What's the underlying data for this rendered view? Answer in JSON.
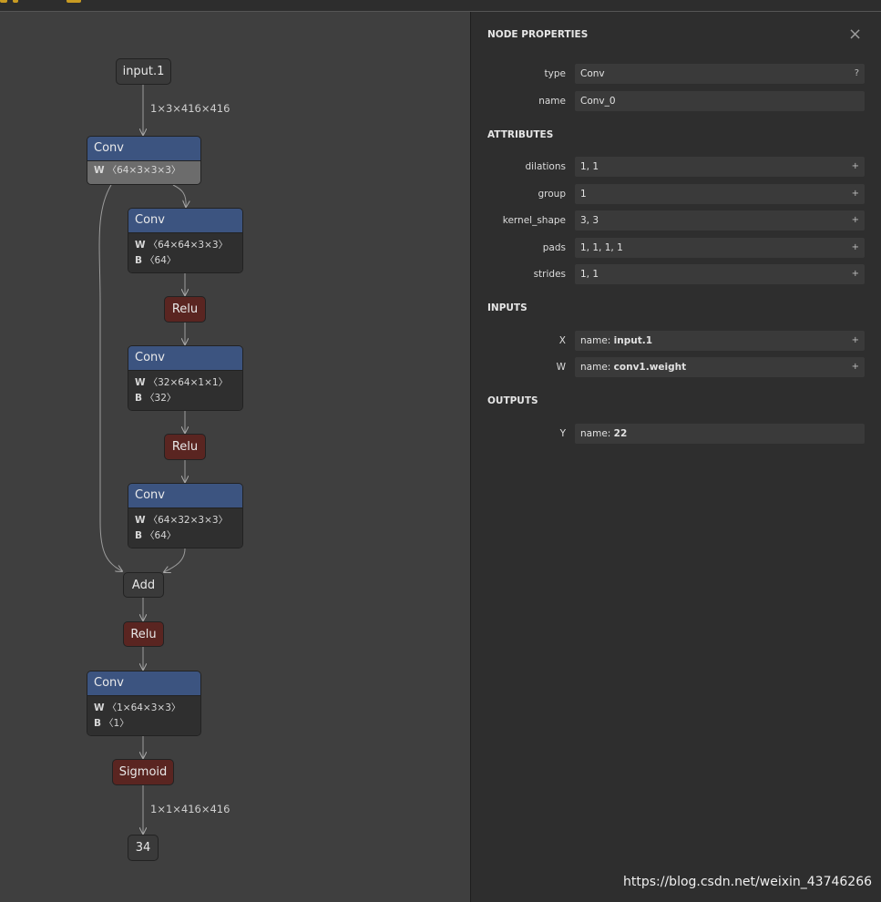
{
  "graph": {
    "input_label": "input.1",
    "input_shape": "1×3×416×416",
    "conv0": {
      "title": "Conv",
      "w_key": "W",
      "w": "〈64×3×3×3〉"
    },
    "conv1": {
      "title": "Conv",
      "w_key": "W",
      "w": "〈64×64×3×3〉",
      "b_key": "B",
      "b": "〈64〉"
    },
    "relu1": "Relu",
    "conv2": {
      "title": "Conv",
      "w_key": "W",
      "w": "〈32×64×1×1〉",
      "b_key": "B",
      "b": "〈32〉"
    },
    "relu2": "Relu",
    "conv3": {
      "title": "Conv",
      "w_key": "W",
      "w": "〈64×32×3×3〉",
      "b_key": "B",
      "b": "〈64〉"
    },
    "add": "Add",
    "relu3": "Relu",
    "conv4": {
      "title": "Conv",
      "w_key": "W",
      "w": "〈1×64×3×3〉",
      "b_key": "B",
      "b": "〈1〉"
    },
    "sigmoid": "Sigmoid",
    "output_shape": "1×1×416×416",
    "output_label": "34"
  },
  "panel": {
    "title": "NODE PROPERTIES",
    "close": "×",
    "type_label": "type",
    "type_value": "Conv",
    "type_action": "?",
    "name_label": "name",
    "name_value": "Conv_0",
    "attributes_title": "ATTRIBUTES",
    "attributes": [
      {
        "label": "dilations",
        "value": "1, 1",
        "action": "+"
      },
      {
        "label": "group",
        "value": "1",
        "action": "+"
      },
      {
        "label": "kernel_shape",
        "value": "3, 3",
        "action": "+"
      },
      {
        "label": "pads",
        "value": "1, 1, 1, 1",
        "action": "+"
      },
      {
        "label": "strides",
        "value": "1, 1",
        "action": "+"
      }
    ],
    "inputs_title": "INPUTS",
    "inputs": [
      {
        "label": "X",
        "prefix": "name: ",
        "value": "input.1",
        "action": "+"
      },
      {
        "label": "W",
        "prefix": "name: ",
        "value": "conv1.weight",
        "action": "+"
      }
    ],
    "outputs_title": "OUTPUTS",
    "outputs": [
      {
        "label": "Y",
        "prefix": "name: ",
        "value": "22"
      }
    ]
  },
  "watermark": "https://blog.csdn.net/weixin_43746266",
  "colors": {
    "op_header": "#3c5480",
    "activation": "#5a2521",
    "panel_bg": "#2e2e2e",
    "canvas_bg": "#3f3f3f"
  }
}
